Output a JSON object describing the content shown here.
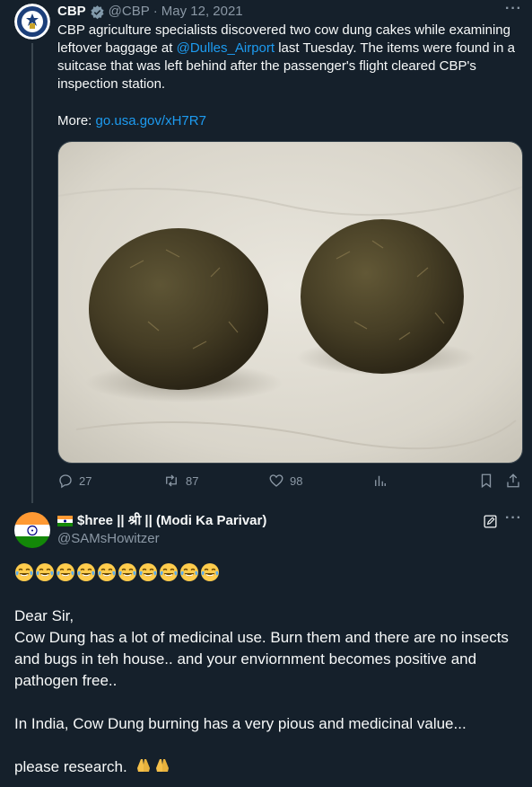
{
  "quoted_tweet": {
    "author_name": "CBP",
    "handle": "@CBP",
    "separator": "·",
    "date": "May 12, 2021",
    "text_part1": "CBP agriculture specialists discovered two cow dung cakes while examining leftover baggage at ",
    "mention": "@Dulles_Airport",
    "text_part2": " last Tuesday. The items were found in a suitcase that was left behind after the passenger's flight cleared CBP's inspection station.",
    "more_label": "More: ",
    "more_link": "go.usa.gov/xH7R7",
    "icons": [
      "cbp-seal-icon",
      "verified-icon",
      "more-icon"
    ],
    "media_alt": "Two round cow dung cakes on a light surface",
    "actions": {
      "replies": "27",
      "reposts": "87",
      "likes": "98"
    },
    "action_icons": [
      "reply-icon",
      "repost-icon",
      "like-icon",
      "views-icon",
      "bookmark-icon",
      "share-icon"
    ]
  },
  "reply": {
    "author_name": "$hree || श्री || (Modi Ka Parivar)",
    "handle": "@SAMsHowitzer",
    "emoji_count": 10,
    "emoji_name": "tears-of-joy-emoji",
    "greeting": "Dear Sir,",
    "paragraph1": "Cow Dung has a lot of medicinal use. Burn them and there are no insects and bugs in teh house.. and your enviornment becomes positive and pathogen free..",
    "paragraph2": "In India, Cow Dung burning has a very pious and medicinal value...",
    "paragraph3": "please research.",
    "icons": [
      "india-flag-icon",
      "edit-icon",
      "more-icon",
      "folded-hands-emoji"
    ]
  },
  "colors": {
    "background": "#15202b",
    "text": "#f7f9f9",
    "muted": "#8b98a5",
    "link": "#1d9bf0",
    "border": "#38444d"
  }
}
